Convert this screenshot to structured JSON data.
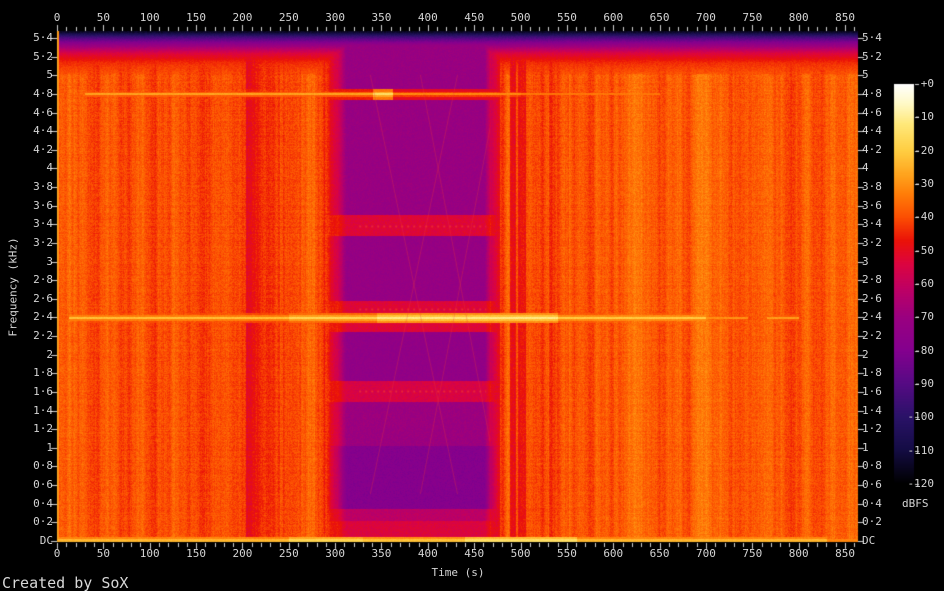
{
  "app": {
    "credit": "Created by SoX"
  },
  "chart_data": {
    "type": "heatmap",
    "subtype": "audio-spectrogram",
    "xlabel": "Time (s)",
    "ylabel": "Frequency (kHz)",
    "x_range_s": [
      0,
      864
    ],
    "x_ticks_s": [
      0,
      50,
      100,
      150,
      200,
      250,
      300,
      350,
      400,
      450,
      500,
      550,
      600,
      650,
      700,
      750,
      800,
      850
    ],
    "x_minor_tick_step_s": 10,
    "y_range_khz": [
      0,
      5.475
    ],
    "y_ticks": [
      {
        "label": "5·4",
        "khz": 5.4
      },
      {
        "label": "5·2",
        "khz": 5.2
      },
      {
        "label": "5",
        "khz": 5.0
      },
      {
        "label": "4·8",
        "khz": 4.8
      },
      {
        "label": "4·6",
        "khz": 4.6
      },
      {
        "label": "4·4",
        "khz": 4.4
      },
      {
        "label": "4·2",
        "khz": 4.2
      },
      {
        "label": "4",
        "khz": 4.0
      },
      {
        "label": "3·8",
        "khz": 3.8
      },
      {
        "label": "3·6",
        "khz": 3.6
      },
      {
        "label": "3·4",
        "khz": 3.4
      },
      {
        "label": "3·2",
        "khz": 3.2
      },
      {
        "label": "3",
        "khz": 3.0
      },
      {
        "label": "2·8",
        "khz": 2.8
      },
      {
        "label": "2·6",
        "khz": 2.6
      },
      {
        "label": "2·4",
        "khz": 2.4
      },
      {
        "label": "2·2",
        "khz": 2.2
      },
      {
        "label": "2",
        "khz": 2.0
      },
      {
        "label": "1·8",
        "khz": 1.8
      },
      {
        "label": "1·6",
        "khz": 1.6
      },
      {
        "label": "1·4",
        "khz": 1.4
      },
      {
        "label": "1·2",
        "khz": 1.2
      },
      {
        "label": "1",
        "khz": 1.0
      },
      {
        "label": "0·8",
        "khz": 0.8
      },
      {
        "label": "0·6",
        "khz": 0.6
      },
      {
        "label": "0·4",
        "khz": 0.4
      },
      {
        "label": "0·2",
        "khz": 0.2
      },
      {
        "label": "DC",
        "khz": 0
      }
    ],
    "colorbar": {
      "label": "dBFS",
      "range_db": [
        0,
        -120
      ],
      "ticks": [
        {
          "label": "+0",
          "db": 0
        },
        {
          "label": "-10",
          "db": -10
        },
        {
          "label": "-20",
          "db": -20
        },
        {
          "label": "-30",
          "db": -30
        },
        {
          "label": "-40",
          "db": -40
        },
        {
          "label": "-50",
          "db": -50
        },
        {
          "label": "-60",
          "db": -60
        },
        {
          "label": "-70",
          "db": -70
        },
        {
          "label": "-80",
          "db": -80
        },
        {
          "label": "-90",
          "db": -90
        },
        {
          "label": "-100",
          "db": -100
        },
        {
          "label": "-110",
          "db": -110
        },
        {
          "label": "-120",
          "db": -120
        }
      ]
    },
    "palette": [
      [
        0,
        "#ffffff"
      ],
      [
        -6,
        "#fff9c4"
      ],
      [
        -12,
        "#ffe878"
      ],
      [
        -20,
        "#ffce42"
      ],
      [
        -27,
        "#ffa41e"
      ],
      [
        -33,
        "#ff7e08"
      ],
      [
        -40,
        "#fc4e02"
      ],
      [
        -47,
        "#ea1208"
      ],
      [
        -54,
        "#dc0440"
      ],
      [
        -62,
        "#bc0066"
      ],
      [
        -70,
        "#9a0080"
      ],
      [
        -80,
        "#84008e"
      ],
      [
        -90,
        "#560a84"
      ],
      [
        -100,
        "#2a1268"
      ],
      [
        -110,
        "#140c44"
      ],
      [
        -120,
        "#000000"
      ]
    ],
    "features": {
      "noise_floor_db": -38,
      "noise_jitter_db": 3,
      "top_rolloff": [
        [
          5.47,
          -115
        ],
        [
          5.42,
          -96
        ],
        [
          5.33,
          -72
        ],
        [
          5.24,
          -54
        ],
        [
          5.14,
          -44
        ],
        [
          5.02,
          -39
        ]
      ],
      "tonal_lines": [
        {
          "freq_khz": 2.4,
          "segments": [
            [
              12,
              250,
              -22
            ],
            [
              250,
              345,
              -17
            ],
            [
              345,
              540,
              -11
            ],
            [
              540,
              700,
              -20
            ],
            [
              700,
              745,
              -30
            ],
            [
              765,
              800,
              -28
            ]
          ]
        },
        {
          "freq_khz": 4.8,
          "segments": [
            [
              30,
              340,
              -27
            ],
            [
              340,
              362,
              -15
            ],
            [
              362,
              500,
              -31
            ],
            [
              500,
              650,
              -34
            ]
          ]
        }
      ],
      "quiet_region": {
        "t_start_s": 302,
        "t_end_s": 467,
        "bands_khz_db": [
          [
            0,
            0.22,
            -54
          ],
          [
            0.22,
            0.35,
            -62
          ],
          [
            0.35,
            1.02,
            -79
          ],
          [
            1.02,
            1.5,
            -70
          ],
          [
            1.5,
            1.72,
            -55
          ],
          [
            1.72,
            2.25,
            -74
          ],
          [
            2.25,
            2.58,
            -53
          ],
          [
            2.58,
            3.28,
            -72
          ],
          [
            3.28,
            3.5,
            -53
          ],
          [
            3.5,
            5.1,
            -71
          ]
        ]
      },
      "vertical_bands_s_db": [
        [
          160,
          200,
          -2
        ],
        [
          203,
          240,
          -7
        ],
        [
          243,
          263,
          -5
        ],
        [
          278,
          288,
          -5
        ],
        [
          288,
          302,
          -3
        ],
        [
          468,
          477,
          -9
        ],
        [
          488,
          495,
          -8
        ],
        [
          497,
          505,
          -7
        ],
        [
          530,
          552,
          -5
        ],
        [
          583,
          600,
          -2
        ],
        [
          812,
          833,
          -2
        ]
      ],
      "dc_line": {
        "freq_span_khz": 0.05,
        "segments": [
          [
            0,
            250,
            -24
          ],
          [
            250,
            330,
            -18
          ],
          [
            330,
            440,
            -22
          ],
          [
            440,
            560,
            -15
          ],
          [
            560,
            830,
            -24
          ],
          [
            830,
            864,
            -32
          ]
        ]
      },
      "diagonal_chirps": [
        [
          338,
          5.0,
          432,
          0.5
        ],
        [
          432,
          5.0,
          338,
          0.5
        ],
        [
          392,
          5.0,
          478,
          0.5
        ],
        [
          478,
          5.0,
          392,
          0.5
        ]
      ],
      "comb_dash_lines_khz": [
        3.38,
        2.49,
        1.61
      ]
    }
  }
}
